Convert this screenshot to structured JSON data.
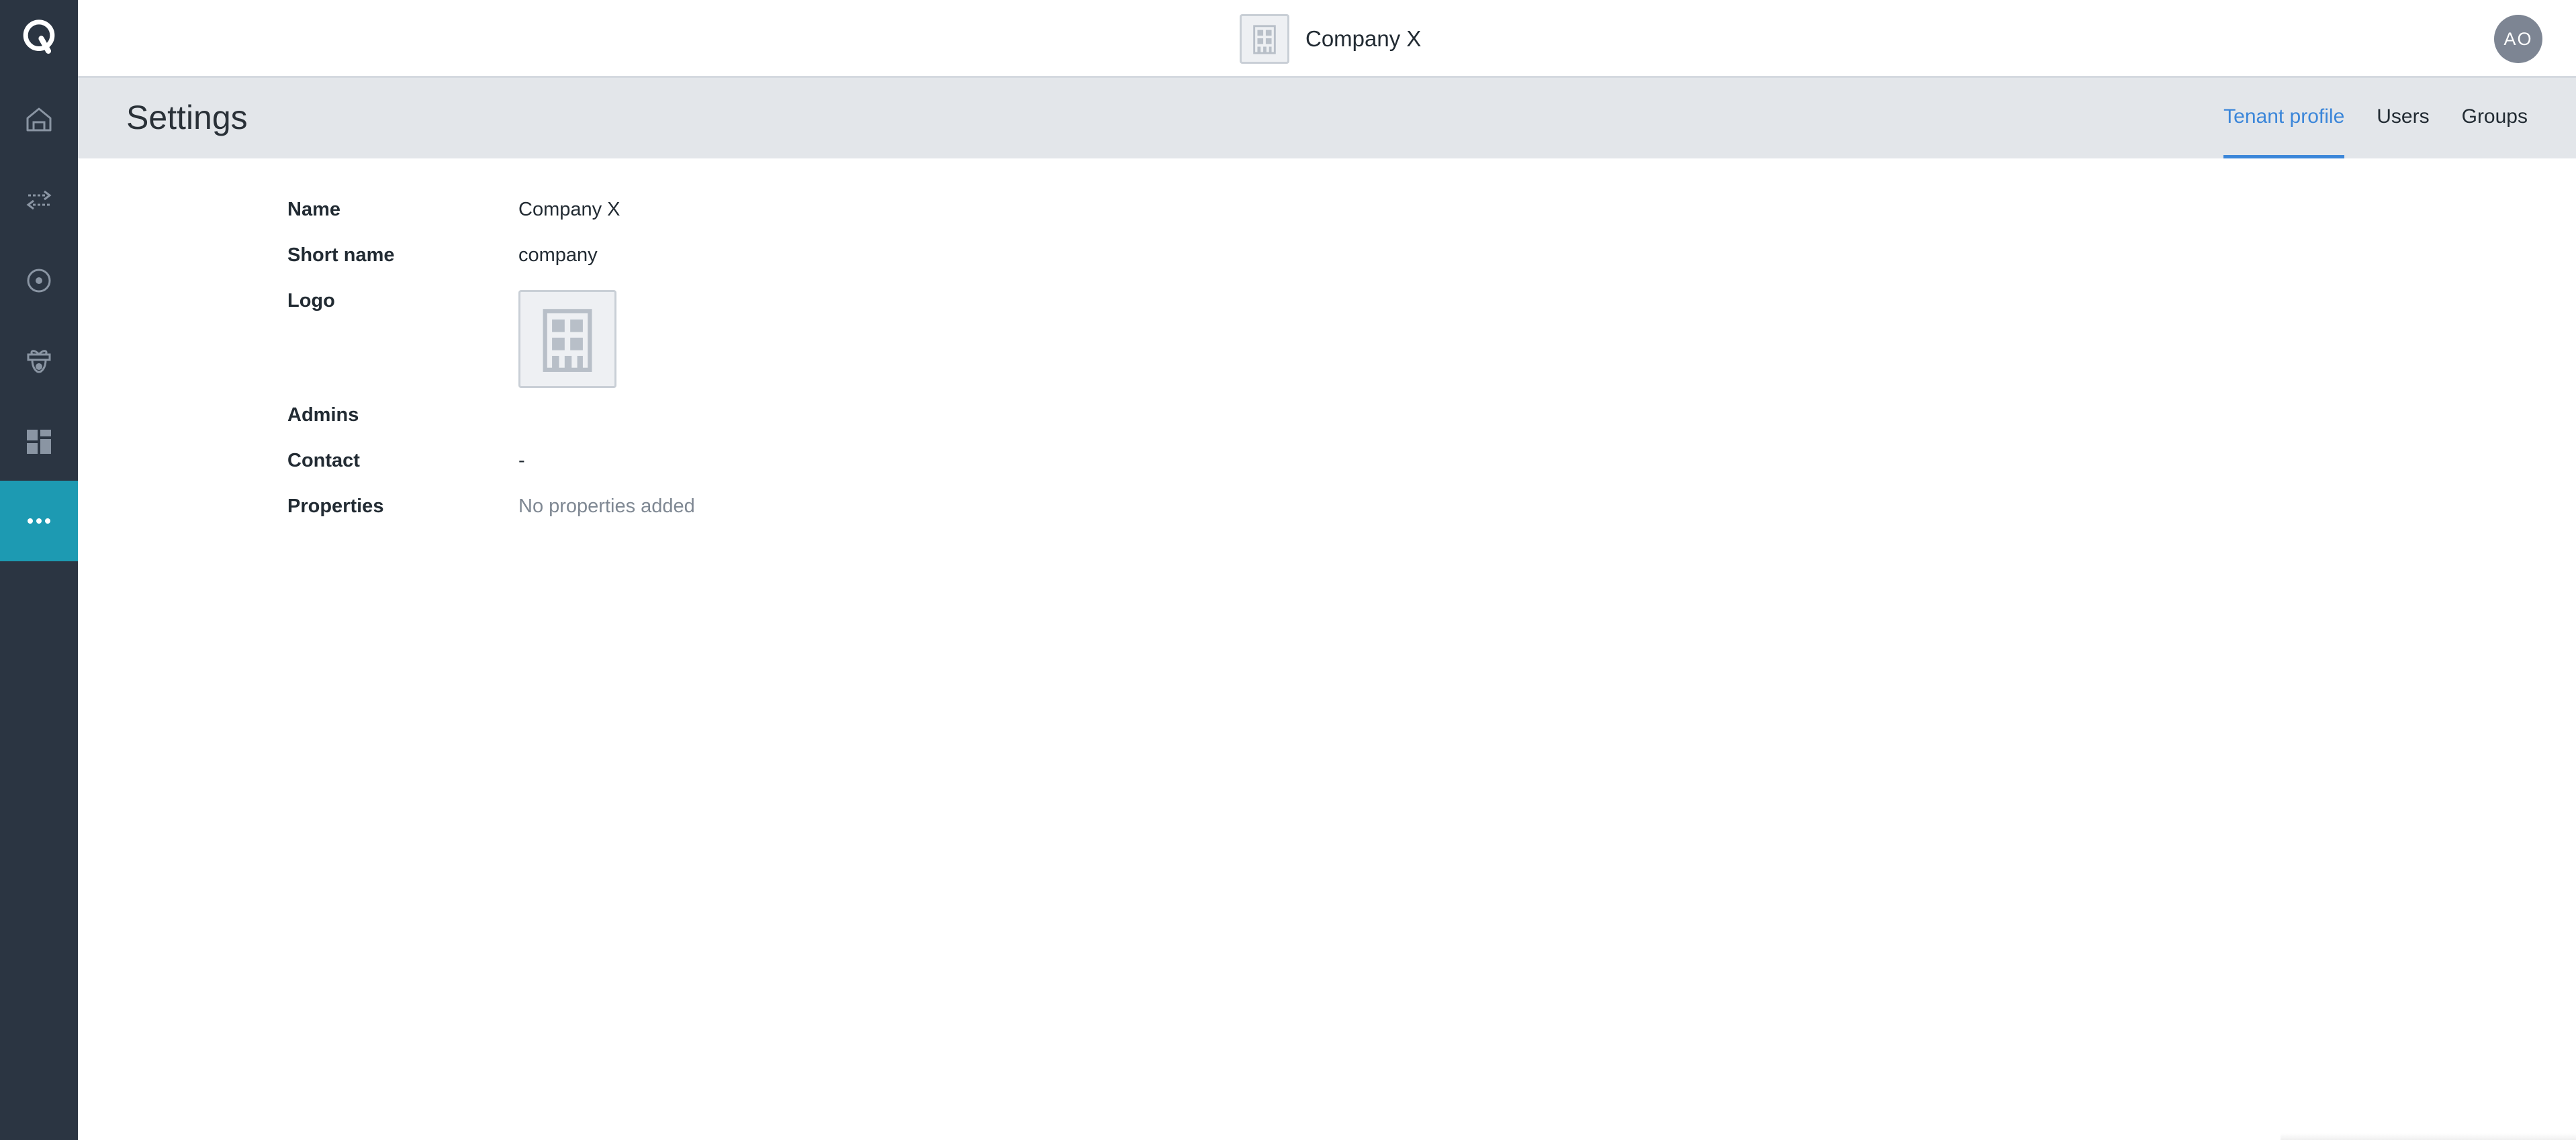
{
  "sidebar": {
    "items": [
      {
        "icon": "q-logo-icon"
      },
      {
        "icon": "home-icon"
      },
      {
        "icon": "transfer-arrows-icon"
      },
      {
        "icon": "target-circle-icon"
      },
      {
        "icon": "gift-icon"
      },
      {
        "icon": "dashboard-grid-icon"
      },
      {
        "icon": "more-dots-icon",
        "active": true
      }
    ]
  },
  "topbar": {
    "tenant_name": "Company X",
    "avatar_initials": "AO"
  },
  "header": {
    "title": "Settings",
    "tabs": [
      {
        "label": "Tenant profile",
        "active": true
      },
      {
        "label": "Users"
      },
      {
        "label": "Groups"
      }
    ]
  },
  "profile": {
    "name_label": "Name",
    "name_value": "Company X",
    "short_name_label": "Short name",
    "short_name_value": "company",
    "logo_label": "Logo",
    "admins_label": "Admins",
    "contact_label": "Contact",
    "contact_value": "-",
    "properties_label": "Properties",
    "properties_value": "No properties added"
  },
  "colors": {
    "sidebar_bg": "#2b3542",
    "sidebar_active": "#1d9ab2",
    "accent": "#3b86d9",
    "header_bg": "#e3e6ea"
  }
}
